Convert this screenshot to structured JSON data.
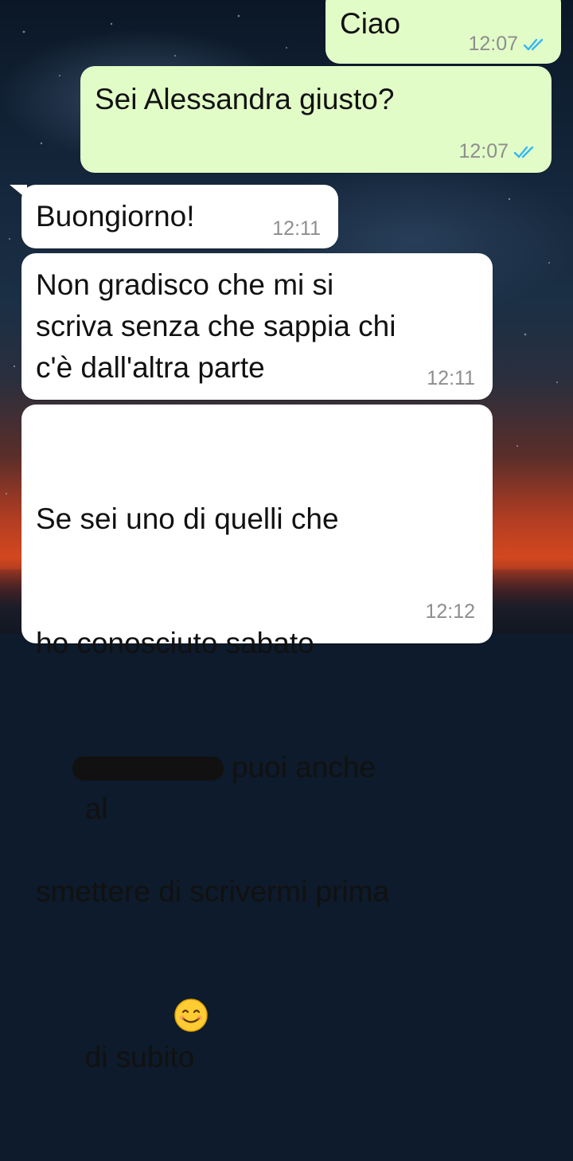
{
  "chat": {
    "messages": [
      {
        "id": "m1",
        "direction": "outgoing",
        "text": "Ciao",
        "time": "12:07",
        "status": "read"
      },
      {
        "id": "m2",
        "direction": "outgoing",
        "text": "Sei Alessandra giusto?",
        "time": "12:07",
        "status": "read"
      },
      {
        "id": "m3",
        "direction": "incoming",
        "text": "Buongiorno!",
        "time": "12:11"
      },
      {
        "id": "m4",
        "direction": "incoming",
        "text": "Non gradisco che mi si\nscriva senza che sappia chi\nc'è dall'altra parte",
        "time": "12:11"
      },
      {
        "id": "m5",
        "direction": "incoming",
        "lines": [
          "Se sei uno di quelli che",
          "ho conosciuto sabato",
          "al",
          "puoi anche",
          "smettere di scrivermi prima",
          "di subito"
        ],
        "time": "12:12",
        "redacted": true,
        "emoji": "smiling-face-icon"
      }
    ]
  },
  "colors": {
    "outgoing_bubble": "#e2fcc8",
    "incoming_bubble": "#ffffff",
    "time": "#8e8e8e",
    "read_ticks": "#34b7f1"
  }
}
